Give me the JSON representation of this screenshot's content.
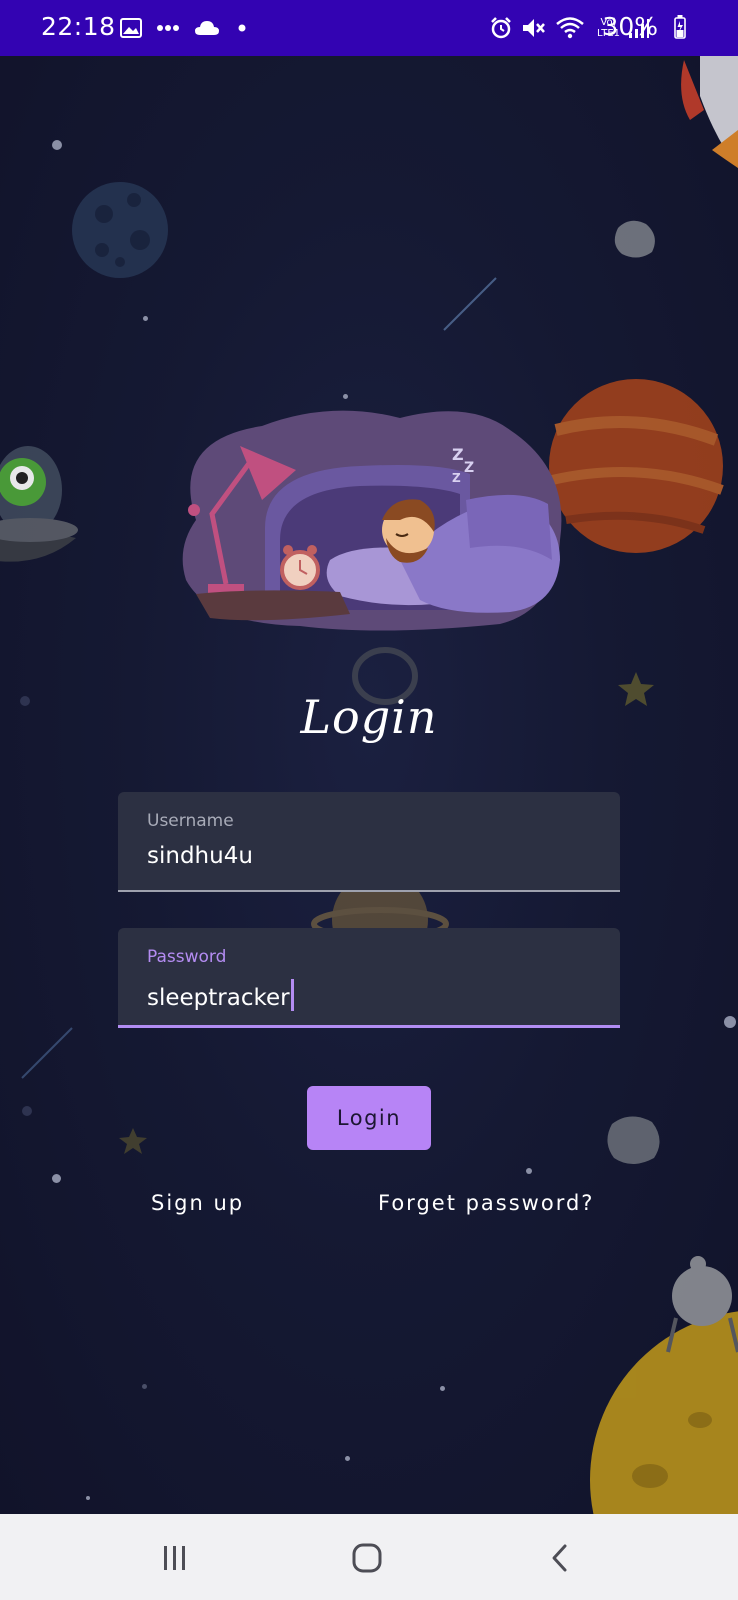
{
  "status_bar": {
    "time": "22:18",
    "battery": "30%",
    "network_badge_top": "Vo)",
    "network_badge_bottom": "LTE1",
    "left_icons": [
      "image-icon",
      "more-dots-icon",
      "cloud-icon",
      "dot-icon"
    ],
    "right_icons": [
      "alarm-icon",
      "mute-icon",
      "wifi-icon",
      "signal-icon",
      "battery-icon"
    ],
    "background": "#3303b2"
  },
  "login": {
    "title": "Login",
    "username_label": "Username",
    "username_value": "sindhu4u",
    "password_label": "Password",
    "password_value": "sleeptracker",
    "login_button": "Login",
    "signup_link": "Sign up",
    "forget_link": "Forget password?"
  },
  "colors": {
    "accent": "#b784f6",
    "background": "#131628",
    "field_background": "#2c3042"
  },
  "navigation": {
    "buttons": [
      "recent-apps-icon",
      "home-icon",
      "back-icon"
    ]
  }
}
